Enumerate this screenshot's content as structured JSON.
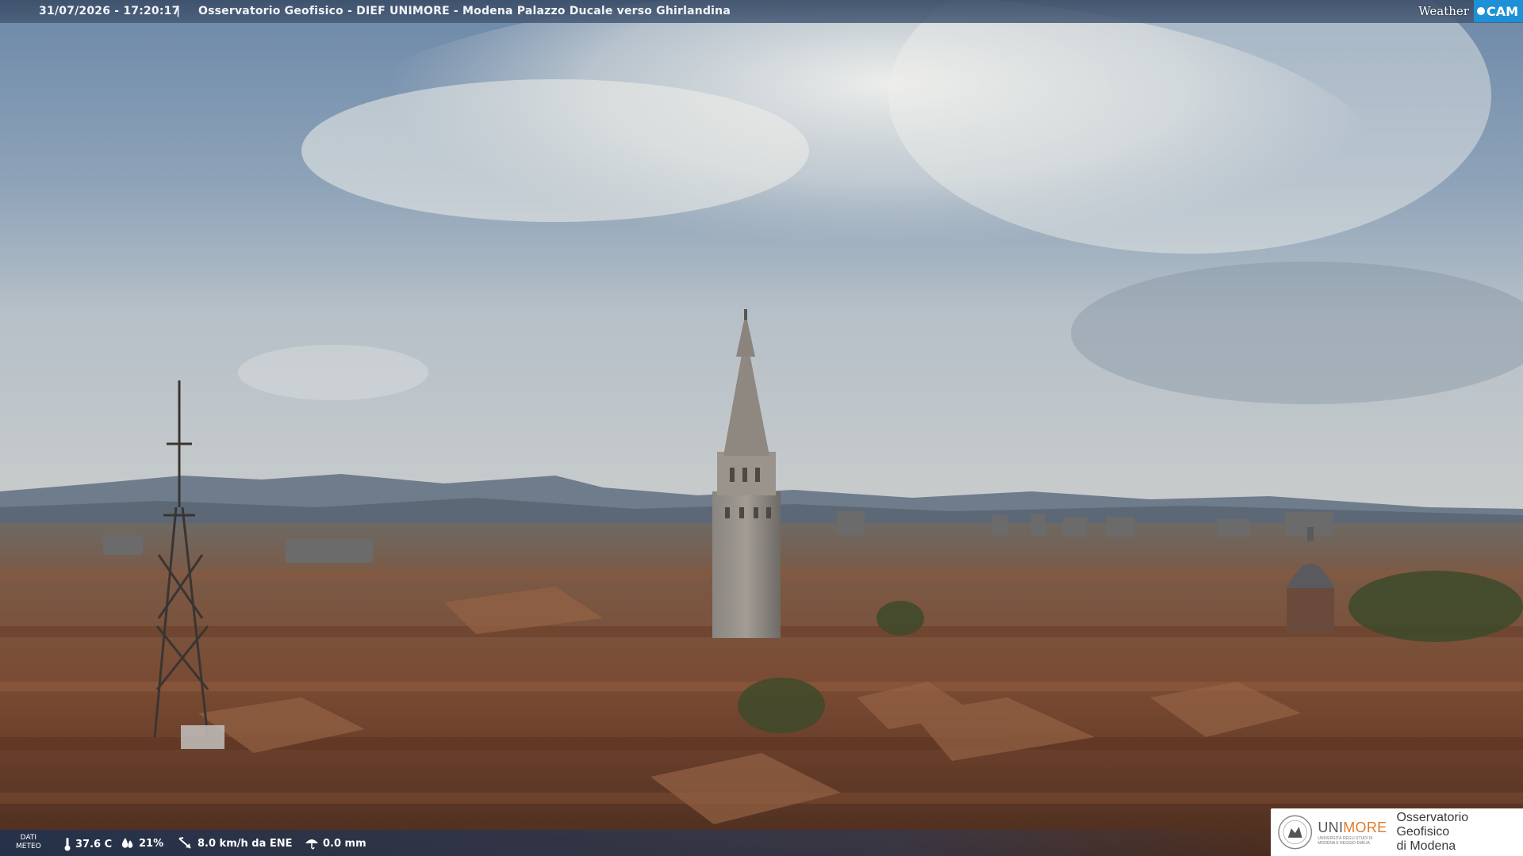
{
  "overlay": {
    "timestamp": "31/07/2026 - 17:20:17",
    "separator": "|",
    "title": "Osservatorio Geofisico - DIEF UNIMORE - Modena Palazzo Ducale verso Ghirlandina"
  },
  "logo": {
    "weather": "Weather",
    "cam": "CAM"
  },
  "meteo": {
    "dati_line1": "DATI",
    "dati_line2": "METEO",
    "temperature": "37.6 C",
    "humidity": "21%",
    "wind": "8.0 km/h da ENE",
    "rain": "0.0 mm"
  },
  "sponsor": {
    "uni": "UNI",
    "more": "MORE",
    "uni_sub1": "UNIVERSITÀ DEGLI STUDI DI",
    "uni_sub2": "MODENA E REGGIO EMILIA",
    "obs_line1": "Osservatorio Geofisico",
    "obs_line2": "di Modena"
  },
  "colors": {
    "sky_top": "#6f8aa8",
    "sky_light": "#e3e6e6",
    "roofs": "#7a4a32",
    "accent_cam": "#1e90d6",
    "accent_more": "#e07a2a"
  }
}
